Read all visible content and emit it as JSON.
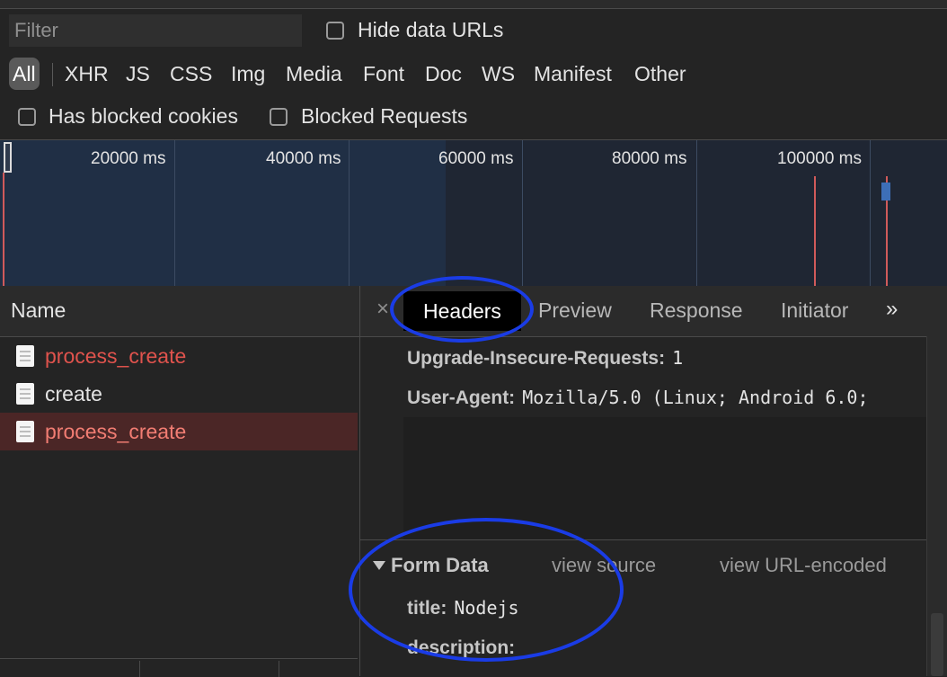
{
  "filter_bar": {
    "filter_placeholder": "Filter",
    "hide_data_urls_label": "Hide data URLs"
  },
  "type_filters": [
    "All",
    "XHR",
    "JS",
    "CSS",
    "Img",
    "Media",
    "Font",
    "Doc",
    "WS",
    "Manifest",
    "Other"
  ],
  "blocked": {
    "has_blocked_cookies_label": "Has blocked cookies",
    "blocked_requests_label": "Blocked Requests"
  },
  "overview": {
    "tick_labels": [
      "20000 ms",
      "40000 ms",
      "60000 ms",
      "80000 ms",
      "100000 ms"
    ]
  },
  "request_list": {
    "column_header": "Name",
    "rows": [
      {
        "name": "process_create",
        "status": "error",
        "selected": false
      },
      {
        "name": "create",
        "status": "ok",
        "selected": false
      },
      {
        "name": "process_create",
        "status": "error",
        "selected": true
      }
    ]
  },
  "details": {
    "close_symbol": "×",
    "tabs": [
      "Headers",
      "Preview",
      "Response",
      "Initiator"
    ],
    "active_tab": "Headers",
    "more_symbol": "»",
    "request_headers": [
      {
        "key": "Upgrade-Insecure-Requests:",
        "value": "1"
      },
      {
        "key": "User-Agent:",
        "value": "Mozilla/5.0 (Linux; Android 6.0;"
      }
    ],
    "form_data": {
      "title": "Form Data",
      "view_source_label": "view source",
      "view_url_encoded_label": "view URL-encoded",
      "fields": [
        {
          "key": "title:",
          "value": "Nodejs"
        },
        {
          "key": "description:",
          "value": ""
        }
      ]
    }
  },
  "colors": {
    "error_text": "#e0534d",
    "selected_row_bg": "#4b2626",
    "annotation_ellipse": "#1a3ce6"
  }
}
